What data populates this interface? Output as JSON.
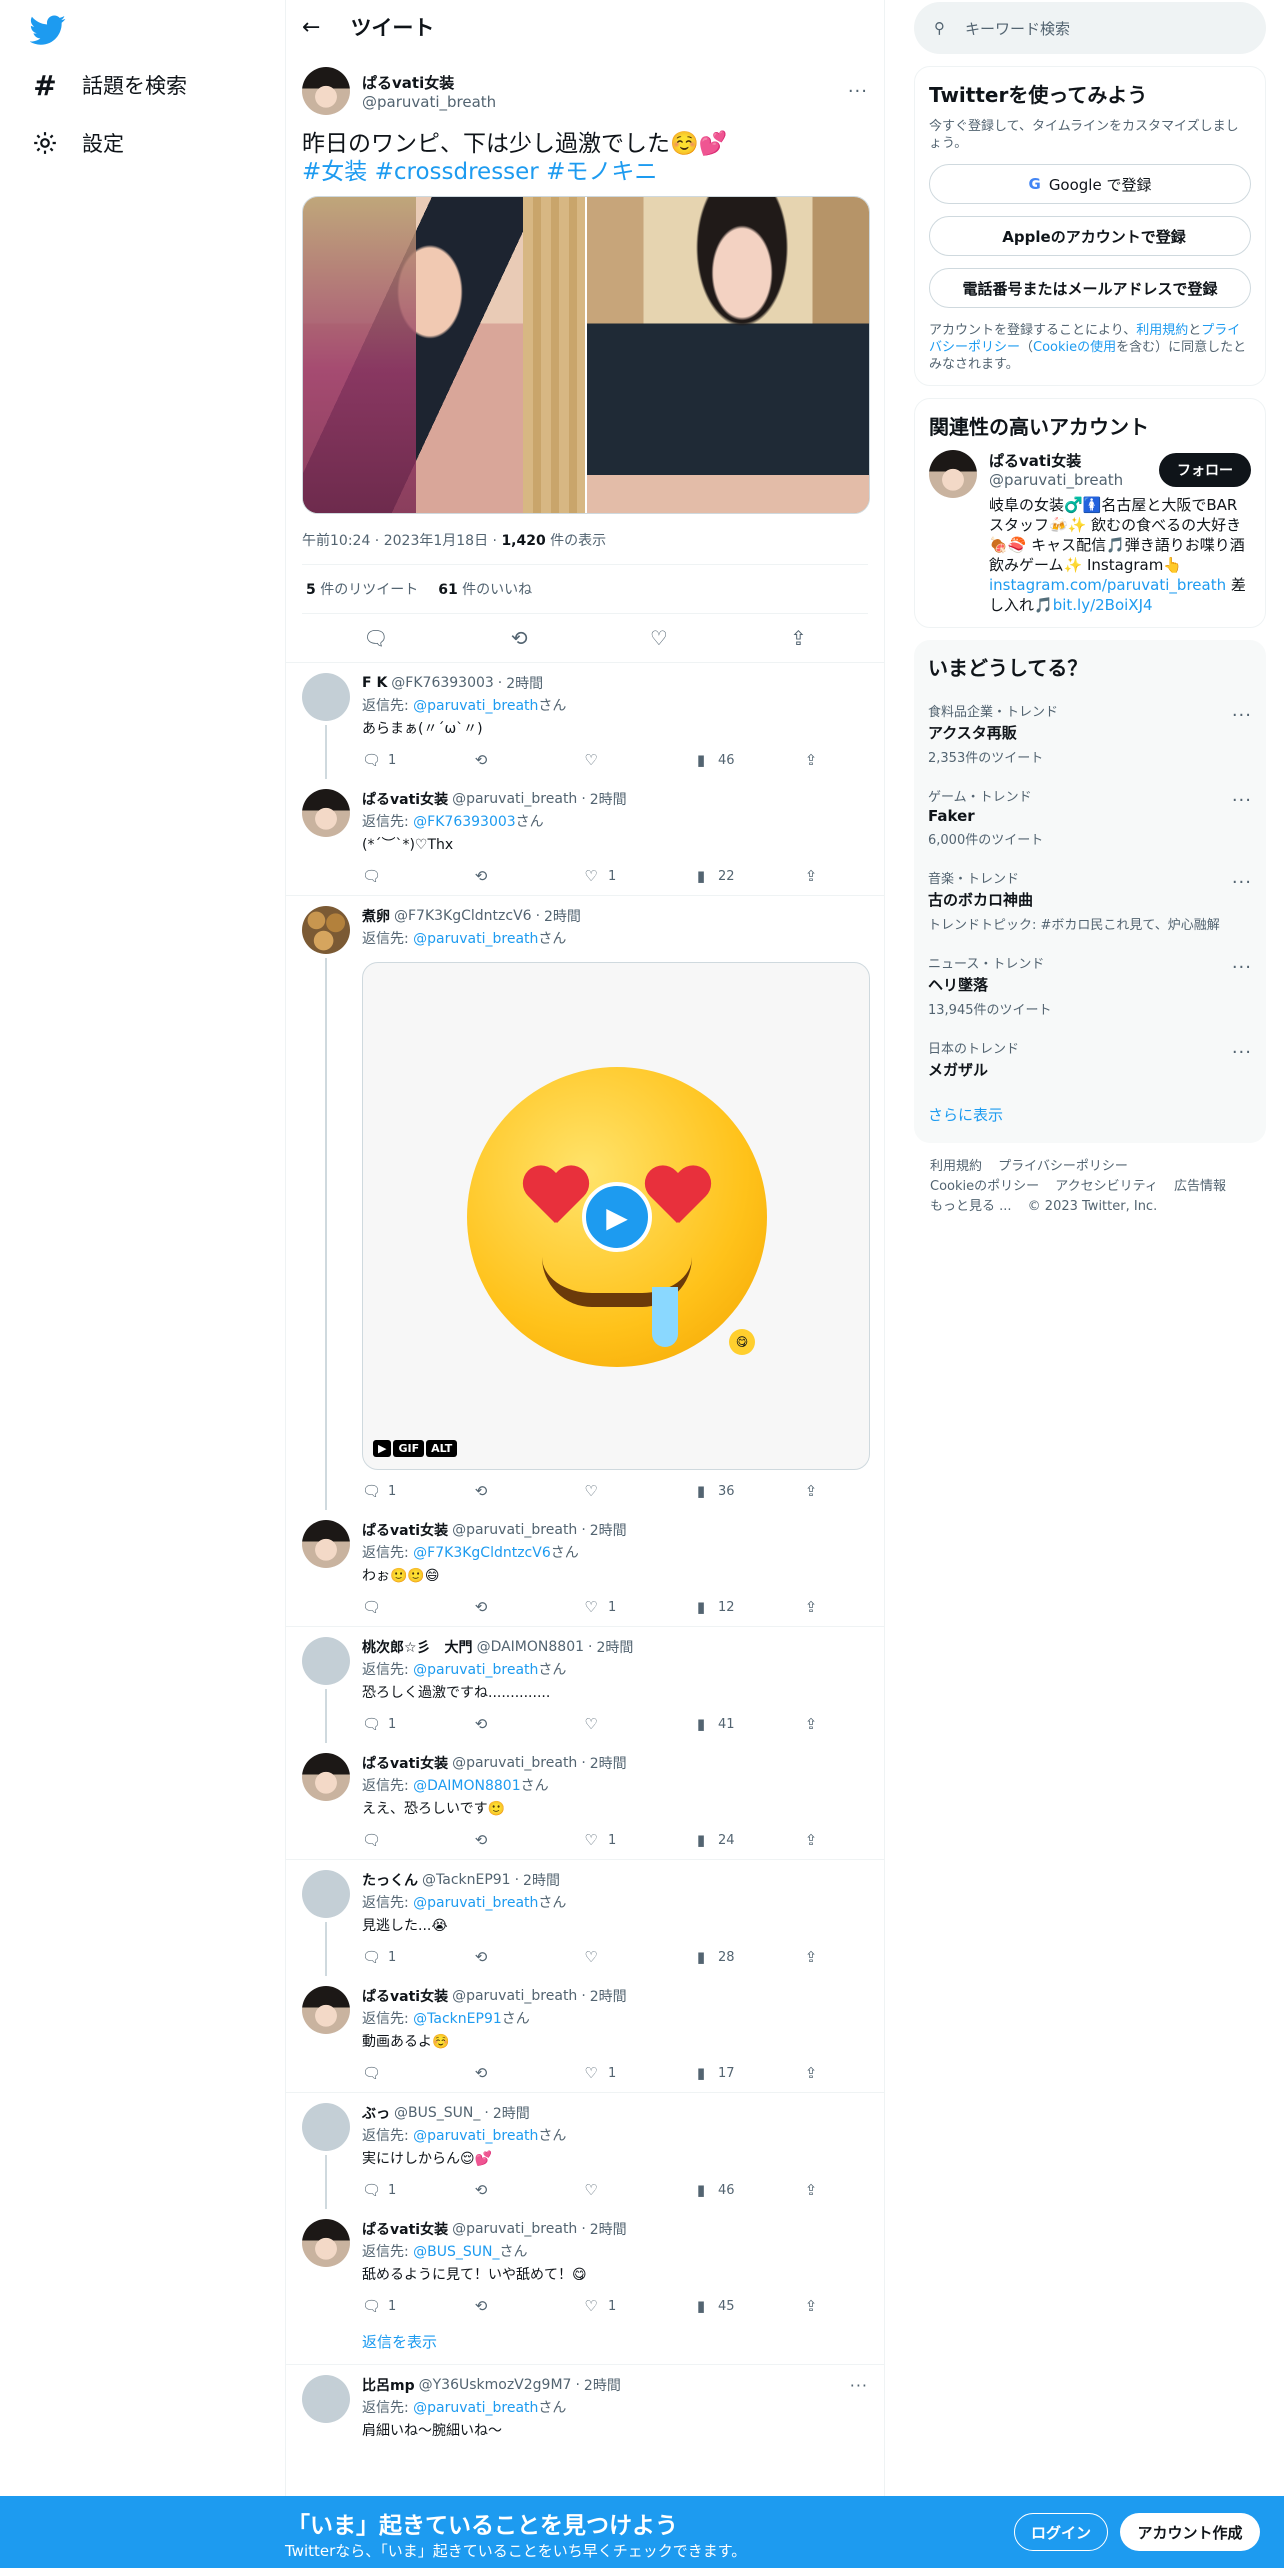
{
  "nav": {
    "explore_label": "話題を検索",
    "settings_label": "設定"
  },
  "header": {
    "title": "ツイート"
  },
  "main_tweet": {
    "name": "ぱるvati女装",
    "handle": "@paruvati_breath",
    "text": "昨日のワンピ、下は少し過激でした☺️💕",
    "hashtags": "#女装 #crossdresser #モノキニ",
    "time": "午前10:24",
    "date": "2023年1月18日",
    "views_count": "1,420",
    "views_label": " 件の表示",
    "retweets_count": "5",
    "retweets_label": " 件のリツイート",
    "likes_count": "61",
    "likes_label": " 件のいいね"
  },
  "replies": [
    {
      "name": "F K",
      "handle": "@FK76393003",
      "time": "2時間",
      "reply_to": "@paruvati_breath",
      "text": "あらまぁ(〃´ω`〃)",
      "reply_count": "1",
      "like_count": "",
      "views": "46"
    },
    {
      "name": "ぱるvati女装",
      "handle": "@paruvati_breath",
      "time": "2時間",
      "reply_to": "@FK76393003",
      "text": "(*´︶`*)♡Thx",
      "reply_count": "",
      "like_count": "1",
      "views": "22"
    },
    {
      "name": "煮卵",
      "handle": "@F7K3KgCldntzcV6",
      "time": "2時間",
      "reply_to": "@paruvati_breath",
      "text": "",
      "reply_count": "1",
      "like_count": "",
      "views": "36"
    },
    {
      "name": "ぱるvati女装",
      "handle": "@paruvati_breath",
      "time": "2時間",
      "reply_to": "@F7K3KgCldntzcV6",
      "text": "わぉ🙂🙂😄",
      "reply_count": "",
      "like_count": "1",
      "views": "12"
    },
    {
      "name": "桃次郎☆彡　大門",
      "handle": "@DAIMON8801",
      "time": "2時間",
      "reply_to": "@paruvati_breath",
      "text": "恐ろしく過激ですね..............",
      "reply_count": "1",
      "like_count": "",
      "views": "41"
    },
    {
      "name": "ぱるvati女装",
      "handle": "@paruvati_breath",
      "time": "2時間",
      "reply_to": "@DAIMON8801",
      "text": "ええ、恐ろしいです🙂",
      "reply_count": "",
      "like_count": "1",
      "views": "24"
    },
    {
      "name": "たっくん",
      "handle": "@TacknEP91",
      "time": "2時間",
      "reply_to": "@paruvati_breath",
      "text": "見逃した...😭",
      "reply_count": "1",
      "like_count": "",
      "views": "28"
    },
    {
      "name": "ぱるvati女装",
      "handle": "@paruvati_breath",
      "time": "2時間",
      "reply_to": "@TacknEP91",
      "text": "動画あるよ☺️",
      "reply_count": "",
      "like_count": "1",
      "views": "17"
    },
    {
      "name": "ぶっ",
      "handle": "@BUS_SUN_",
      "time": "2時間",
      "reply_to": "@paruvati_breath",
      "text": "実にけしからん😌💕",
      "reply_count": "1",
      "like_count": "",
      "views": "46"
    },
    {
      "name": "ぱるvati女装",
      "handle": "@paruvati_breath",
      "time": "2時間",
      "reply_to": "@BUS_SUN_",
      "text": "舐めるように見て！いや舐めて！😋",
      "reply_count": "1",
      "like_count": "1",
      "views": "45"
    },
    {
      "name": "比呂mp",
      "handle": "@Y36UskmozV2g9M7",
      "time": "2時間",
      "reply_to": "@paruvati_breath",
      "text": "肩細いね～腕細いね～",
      "reply_count": "",
      "like_count": "",
      "views": ""
    }
  ],
  "common": {
    "reply_to_prefix": "返信先: ",
    "reply_to_suffix": "さん",
    "show_replies": "返信を表示",
    "gif_badge": "GIF",
    "alt_badge": "ALT"
  },
  "right": {
    "search_placeholder": "キーワード検索",
    "signup_card": {
      "title": "Twitterを使ってみよう",
      "subtitle": "今すぐ登録して、タイムラインをカスタマイズしましょう。",
      "google_btn": "Google で登録",
      "apple_btn": "Appleのアカウントで登録",
      "phone_btn": "電話番号またはメールアドレスで登録",
      "terms_pre": "アカウントを登録することにより、",
      "terms_link1": "利用規約",
      "terms_mid": "と",
      "terms_link2": "プライバシーポリシー",
      "terms_mid2": "（",
      "terms_link3": "Cookieの使用",
      "terms_post": "を含む）に同意したとみなされます。"
    },
    "related": {
      "title": "関連性の高いアカウント",
      "name": "ぱるvati女装",
      "handle": "@paruvati_breath",
      "follow": "フォロー",
      "bio": "岐阜の女装♂️🚺名古屋と大阪でBARスタッフ🍻✨ 飲むの食べるの大好き🍖🍣 キャス配信🎵弾き語りお喋り酒飲みゲーム✨ Instagram👆",
      "link1": "instagram.com/paruvati_breath",
      "bio2": " 差し入れ🎵",
      "link2": "bit.ly/2BoiXJ4"
    },
    "trends": {
      "title": "いまどうしてる？",
      "items": [
        {
          "cat": "食料品企業・トレンド",
          "name": "アクスタ再販",
          "cnt": "2,353件のツイート"
        },
        {
          "cat": "ゲーム・トレンド",
          "name": "Faker",
          "cnt": "6,000件のツイート"
        },
        {
          "cat": "音楽・トレンド",
          "name": "古のボカロ神曲",
          "cnt": "トレンドトピック: #ボカロ民これ見て、炉心融解"
        },
        {
          "cat": "ニュース・トレンド",
          "name": "ヘリ墜落",
          "cnt": "13,945件のツイート"
        },
        {
          "cat": "日本のトレンド",
          "name": "メガザル",
          "cnt": ""
        }
      ],
      "show_more": "さらに表示"
    },
    "footer": {
      "terms": "利用規約",
      "privacy": "プライバシーポリシー",
      "cookie": "Cookieのポリシー",
      "access": "アクセシビリティ",
      "ads": "広告情報",
      "more": "もっと見る ...",
      "copyright": "© 2023 Twitter, Inc."
    }
  },
  "bottom_bar": {
    "title": "「いま」起きていることを見つけよう",
    "subtitle": "Twitterなら、「いま」起きていることをいち早くチェックできます。",
    "login": "ログイン",
    "signup": "アカウント作成"
  },
  "colors": {
    "accent": "#1d9bf0",
    "text": "#0f1419",
    "muted": "#536471"
  }
}
